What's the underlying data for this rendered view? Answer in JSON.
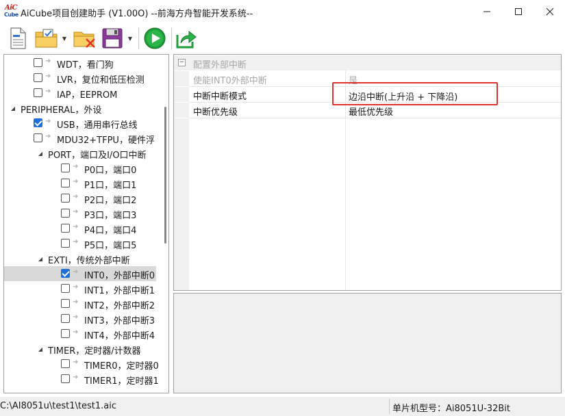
{
  "window": {
    "logo_top": "AiC",
    "logo_bottom": "Cube",
    "title": "AiCube项目创建助手 (V1.00O) --前海方舟智能开发系统--"
  },
  "tree": {
    "items": [
      {
        "label": "WDT，看门狗",
        "checked": false
      },
      {
        "label": "LVR，复位和低压检测",
        "checked": false
      },
      {
        "label": "IAP，EEPROM",
        "checked": false
      },
      {
        "label": "PERIPHERAL，外设"
      },
      {
        "label": "USB，通用串行总线",
        "checked": true
      },
      {
        "label": "MDU32+TFPU，硬件浮",
        "checked": false
      },
      {
        "label": "PORT，端口及I/O口中断"
      },
      {
        "label": "P0口，端口0",
        "checked": false
      },
      {
        "label": "P1口，端口1",
        "checked": false
      },
      {
        "label": "P2口，端口2",
        "checked": false
      },
      {
        "label": "P3口，端口3",
        "checked": false
      },
      {
        "label": "P4口，端口4",
        "checked": false
      },
      {
        "label": "P5口，端口5",
        "checked": false
      },
      {
        "label": "EXTI，传统外部中断"
      },
      {
        "label": "INT0，外部中断0",
        "checked": true,
        "selected": true
      },
      {
        "label": "INT1，外部中断1",
        "checked": false
      },
      {
        "label": "INT2，外部中断2",
        "checked": false
      },
      {
        "label": "INT3，外部中断3",
        "checked": false
      },
      {
        "label": "INT4，外部中断4",
        "checked": false
      },
      {
        "label": "TIMER，定时器/计数器"
      },
      {
        "label": "TIMER0，定时器0",
        "checked": false
      },
      {
        "label": "TIMER1，定时器1",
        "checked": false
      }
    ]
  },
  "properties": {
    "category": "配置外部中断",
    "rows": [
      {
        "name": "使能INT0外部中断",
        "value": "是",
        "disabled": true
      },
      {
        "name": "中断中断模式",
        "value": "边沿中断(上升沿 + 下降沿)",
        "disabled": false
      },
      {
        "name": "中断优先级",
        "value": "最低优先级",
        "disabled": false
      }
    ]
  },
  "status": {
    "path": "C:\\AI8051u\\test1\\test1.aic",
    "chip": "单片机型号：Ai8051U-32Bit"
  }
}
